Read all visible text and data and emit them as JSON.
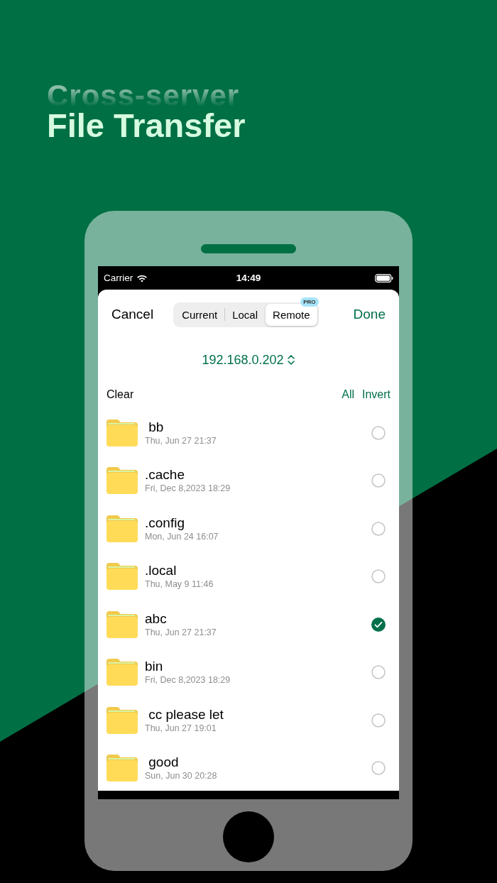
{
  "headline": {
    "overline": "Cross-server",
    "title": "File Transfer"
  },
  "status_bar": {
    "carrier": "Carrier",
    "time": "14:49"
  },
  "nav": {
    "cancel": "Cancel",
    "done": "Done",
    "segments": [
      {
        "label": "Current",
        "selected": false
      },
      {
        "label": "Local",
        "selected": false
      },
      {
        "label": "Remote",
        "selected": true,
        "badge": "PRO"
      }
    ]
  },
  "server": {
    "address": "192.168.0.202"
  },
  "actions": {
    "clear": "Clear",
    "all": "All",
    "invert": "Invert"
  },
  "files": [
    {
      "name": " bb",
      "date": "Thu, Jun 27 21:37",
      "checked": false
    },
    {
      "name": ".cache",
      "date": "Fri, Dec 8,2023 18:29",
      "checked": false
    },
    {
      "name": ".config",
      "date": "Mon, Jun 24 16:07",
      "checked": false
    },
    {
      "name": ".local",
      "date": "Thu, May 9 11:46",
      "checked": false
    },
    {
      "name": "abc",
      "date": "Thu, Jun 27 21:37",
      "checked": true
    },
    {
      "name": "bin",
      "date": "Fri, Dec 8,2023 18:29",
      "checked": false
    },
    {
      "name": " cc please let",
      "date": "Thu, Jun 27 19:01",
      "checked": false
    },
    {
      "name": " good",
      "date": "Sun, Jun 30 20:28",
      "checked": false
    }
  ]
}
